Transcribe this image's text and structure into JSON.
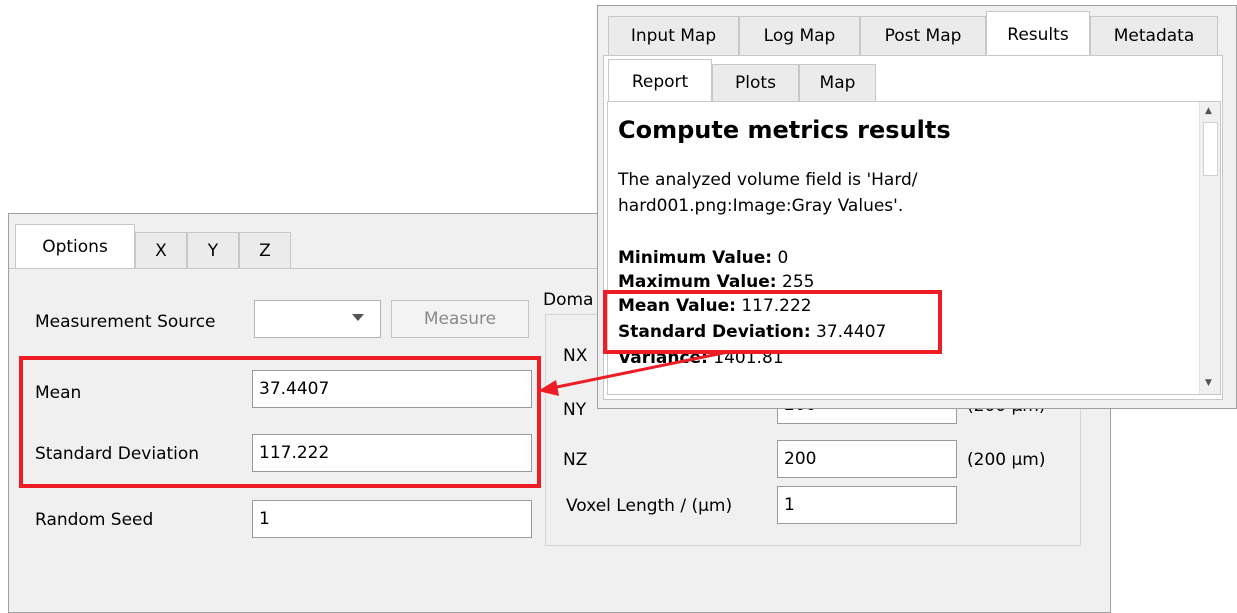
{
  "options_panel": {
    "tabs": [
      "Options",
      "X",
      "Y",
      "Z"
    ],
    "domain_label": "Doma",
    "measurement_source_label": "Measurement Source",
    "measurement_source_value": "",
    "measure_button": "Measure",
    "mean_label": "Mean",
    "mean_value": "37.4407",
    "std_label": "Standard Deviation",
    "std_value": "117.222",
    "seed_label": "Random Seed",
    "seed_value": "1",
    "nx_label": "NX",
    "ny_label": "NY",
    "ny_value": "200",
    "ny_unit": "(200 μm)",
    "nz_label": "NZ",
    "nz_value": "200",
    "nz_unit": "(200 μm)",
    "voxel_label": "Voxel Length / (μm)",
    "voxel_value": "1"
  },
  "results_panel": {
    "tabs": [
      "Input Map",
      "Log Map",
      "Post Map",
      "Results",
      "Metadata"
    ],
    "subtabs": [
      "Report",
      "Plots",
      "Map"
    ],
    "title": "Compute metrics results",
    "desc_line1": "The analyzed volume field is 'Hard/",
    "desc_line2": "hard001.png:Image:Gray Values'.",
    "stats": [
      {
        "label": "Minimum Value:",
        "value": "0"
      },
      {
        "label": "Maximum Value:",
        "value": "255"
      },
      {
        "label": "Mean Value:",
        "value": "117.222"
      },
      {
        "label": "Standard Deviation:",
        "value": "37.4407"
      },
      {
        "label": "Variance:",
        "value": "1401.81"
      }
    ]
  },
  "colors": {
    "highlight": "#ee1c25",
    "window_bg": "#f0f0f0"
  }
}
